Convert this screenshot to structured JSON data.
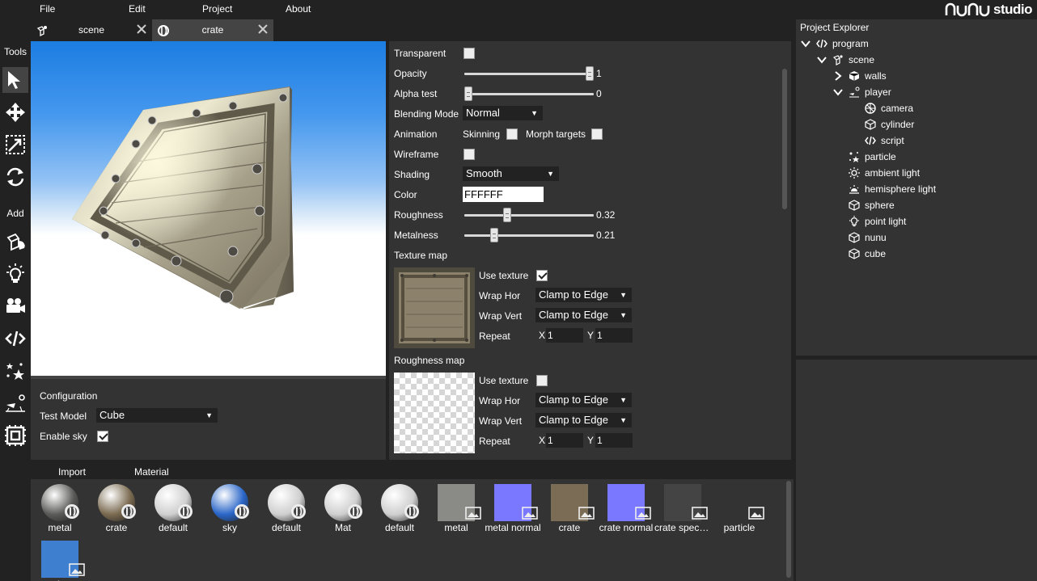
{
  "menu": {
    "items": [
      "File",
      "Edit",
      "Project",
      "About"
    ],
    "logo_text": "studio"
  },
  "tabs": [
    {
      "label": "scene",
      "icon": "scene-icon",
      "active": false
    },
    {
      "label": "crate",
      "icon": "material-icon",
      "active": true
    }
  ],
  "toolbar": {
    "tools_label": "Tools",
    "add_label": "Add",
    "tools": [
      "select-icon",
      "move-icon",
      "scale-icon",
      "rotate-icon"
    ],
    "add": [
      "add-model-icon",
      "add-light-icon",
      "add-camera-icon",
      "add-script-icon",
      "add-effects-icon",
      "add-physics-icon",
      "add-ui-icon"
    ]
  },
  "config": {
    "title": "Configuration",
    "test_model_label": "Test Model",
    "test_model_value": "Cube",
    "enable_sky_label": "Enable sky",
    "enable_sky_checked": true
  },
  "material": {
    "transparent_label": "Transparent",
    "opacity_label": "Opacity",
    "opacity_value": "1",
    "opacity_fraction": 1.0,
    "alpha_test_label": "Alpha test",
    "alpha_test_value": "0",
    "alpha_test_fraction": 0.0,
    "blending_label": "Blending Mode",
    "blending_value": "Normal",
    "animation_label": "Animation",
    "skinning_label": "Skinning",
    "morph_label": "Morph targets",
    "wireframe_label": "Wireframe",
    "shading_label": "Shading",
    "shading_value": "Smooth",
    "color_label": "Color",
    "color_value": "FFFFFF",
    "roughness_label": "Roughness",
    "roughness_value": "0.32",
    "roughness_fraction": 0.32,
    "metalness_label": "Metalness",
    "metalness_value": "0.21",
    "metalness_fraction": 0.21,
    "texture_map": {
      "title": "Texture map",
      "use_texture_label": "Use texture",
      "use_texture_checked": true,
      "wrap_hor_label": "Wrap Hor",
      "wrap_hor_value": "Clamp to Edge",
      "wrap_vert_label": "Wrap Vert",
      "wrap_vert_value": "Clamp to Edge",
      "repeat_label": "Repeat",
      "x_label": "X",
      "x_value": "1",
      "y_label": "Y",
      "y_value": "1"
    },
    "roughness_map": {
      "title": "Roughness map",
      "use_texture_label": "Use texture",
      "use_texture_checked": false,
      "wrap_hor_label": "Wrap Hor",
      "wrap_hor_value": "Clamp to Edge",
      "wrap_vert_label": "Wrap Vert",
      "wrap_vert_value": "Clamp to Edge",
      "repeat_label": "Repeat",
      "x_label": "X",
      "x_value": "1",
      "y_label": "Y",
      "y_value": "1"
    }
  },
  "explorer": {
    "title": "Project Explorer",
    "tree": [
      {
        "label": "program",
        "icon": "code-icon",
        "expanded": true
      },
      {
        "label": "scene",
        "icon": "scene-icon",
        "expanded": true
      },
      {
        "label": "walls",
        "icon": "cube-icon",
        "expanded": false
      },
      {
        "label": "player",
        "icon": "physics-icon",
        "expanded": true
      },
      {
        "label": "camera",
        "icon": "camera-icon"
      },
      {
        "label": "cylinder",
        "icon": "cube-outline-icon"
      },
      {
        "label": "script",
        "icon": "code-icon"
      },
      {
        "label": "particle",
        "icon": "particle-icon"
      },
      {
        "label": "ambient light",
        "icon": "light-icon"
      },
      {
        "label": "hemisphere light",
        "icon": "hemisphere-icon"
      },
      {
        "label": "sphere",
        "icon": "cube-outline-icon"
      },
      {
        "label": "point light",
        "icon": "bulb-icon"
      },
      {
        "label": "nunu",
        "icon": "cube-outline-icon"
      },
      {
        "label": "cube",
        "icon": "cube-outline-icon"
      }
    ]
  },
  "asset_tabs": [
    "Import",
    "Material"
  ],
  "assets": [
    {
      "name": "metal",
      "kind": "material",
      "color": "#5a5a58"
    },
    {
      "name": "crate",
      "kind": "material",
      "color": "#7a6a50"
    },
    {
      "name": "default",
      "kind": "material",
      "color": "#cfcfcf"
    },
    {
      "name": "sky",
      "kind": "material",
      "color": "#2a66c8"
    },
    {
      "name": "default",
      "kind": "material",
      "color": "#cfcfcf"
    },
    {
      "name": "Mat",
      "kind": "material",
      "color": "#cfcfcf"
    },
    {
      "name": "default",
      "kind": "material",
      "color": "#cfcfcf"
    },
    {
      "name": "metal",
      "kind": "texture",
      "color": "#8a8a86"
    },
    {
      "name": "metal normal",
      "kind": "texture",
      "color": "#7a78ff"
    },
    {
      "name": "crate",
      "kind": "texture",
      "color": "#7b6c55"
    },
    {
      "name": "crate normal",
      "kind": "texture",
      "color": "#7a78ff"
    },
    {
      "name": "crate specular",
      "kind": "texture",
      "color": "#444444"
    },
    {
      "name": "particle",
      "kind": "texture",
      "color": "#333333"
    },
    {
      "name": "sky",
      "kind": "texture",
      "color": "#3f7fd0"
    }
  ],
  "colors": {
    "background": "#222222",
    "panel": "#333333",
    "active_tab": "#444444",
    "accent": "#ffffff"
  }
}
